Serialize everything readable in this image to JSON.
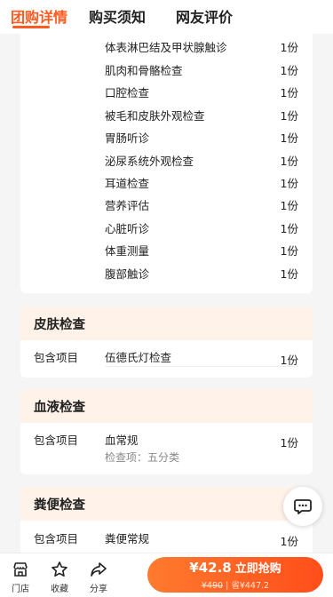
{
  "tabs": [
    "团购详情",
    "购买须知",
    "网友评价"
  ],
  "card1": {
    "items": [
      {
        "name": "体表淋巴结及甲状腺触诊",
        "qty": "1份"
      },
      {
        "name": "肌肉和骨骼检查",
        "qty": "1份"
      },
      {
        "name": "口腔检查",
        "qty": "1份"
      },
      {
        "name": "被毛和皮肤外观检查",
        "qty": "1份"
      },
      {
        "name": "胃肠听诊",
        "qty": "1份"
      },
      {
        "name": "泌尿系统外观检查",
        "qty": "1份"
      },
      {
        "name": "耳道检查",
        "qty": "1份"
      },
      {
        "name": "营养评估",
        "qty": "1份"
      },
      {
        "name": "心脏听诊",
        "qty": "1份"
      },
      {
        "name": "体重测量",
        "qty": "1份"
      },
      {
        "name": "腹部触诊",
        "qty": "1份"
      }
    ]
  },
  "card2": {
    "title": "皮肤检查",
    "label": "包含项目",
    "item": "伍德氏灯检查",
    "qty": "1份"
  },
  "card3": {
    "title": "血液检查",
    "label": "包含项目",
    "item": "血常规",
    "qty": "1份",
    "sub": "检查项：五分类"
  },
  "card4": {
    "title": "粪便检查",
    "label": "包含项目",
    "item": "粪便常规",
    "qty": "1份"
  },
  "bottom": {
    "store": "门店",
    "fav": "收藏",
    "share": "分享",
    "price": "¥42.8",
    "cta": "立即抢购",
    "orig": "¥490",
    "save": "省¥447.2"
  },
  "colors": {
    "accent": "#ff5a1f",
    "card_header": "#fff2e9"
  }
}
